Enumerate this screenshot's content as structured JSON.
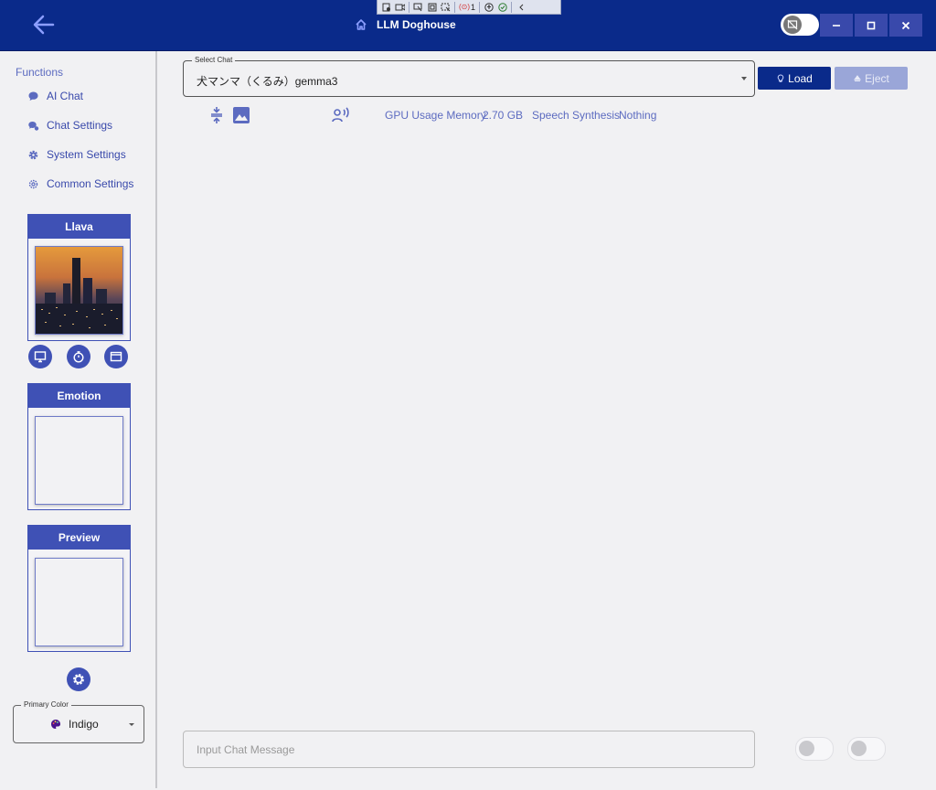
{
  "window": {
    "title": "LLM Doghouse",
    "debug_badge_count": "1"
  },
  "sidebar": {
    "functions_label": "Functions",
    "items": [
      {
        "label": "AI Chat",
        "icon": "chat-bubble-icon"
      },
      {
        "label": "Chat Settings",
        "icon": "chat-settings-icon"
      },
      {
        "label": "System Settings",
        "icon": "gear-icon"
      },
      {
        "label": "Common Settings",
        "icon": "settings-cog-icon"
      }
    ],
    "llava_title": "Llava",
    "emotion_title": "Emotion",
    "preview_title": "Preview",
    "primary_color_label": "Primary Color",
    "primary_color_value": "Indigo"
  },
  "main": {
    "select_chat_label": "Select Chat",
    "select_chat_value": "犬マンマ（くるみ）gemma3",
    "load_label": "Load",
    "eject_label": "Eject",
    "gpu_label": "GPU Usage Memory",
    "gpu_value": "2.70 GB",
    "speech_label": "Speech Synthesis",
    "speech_value": "Nothing",
    "input_placeholder": "Input Chat Message"
  },
  "colors": {
    "titlebar": "#0a2a8a",
    "primary": "#3f51b5",
    "accent_text": "#5c6bc0",
    "background": "#f1f1f3"
  }
}
